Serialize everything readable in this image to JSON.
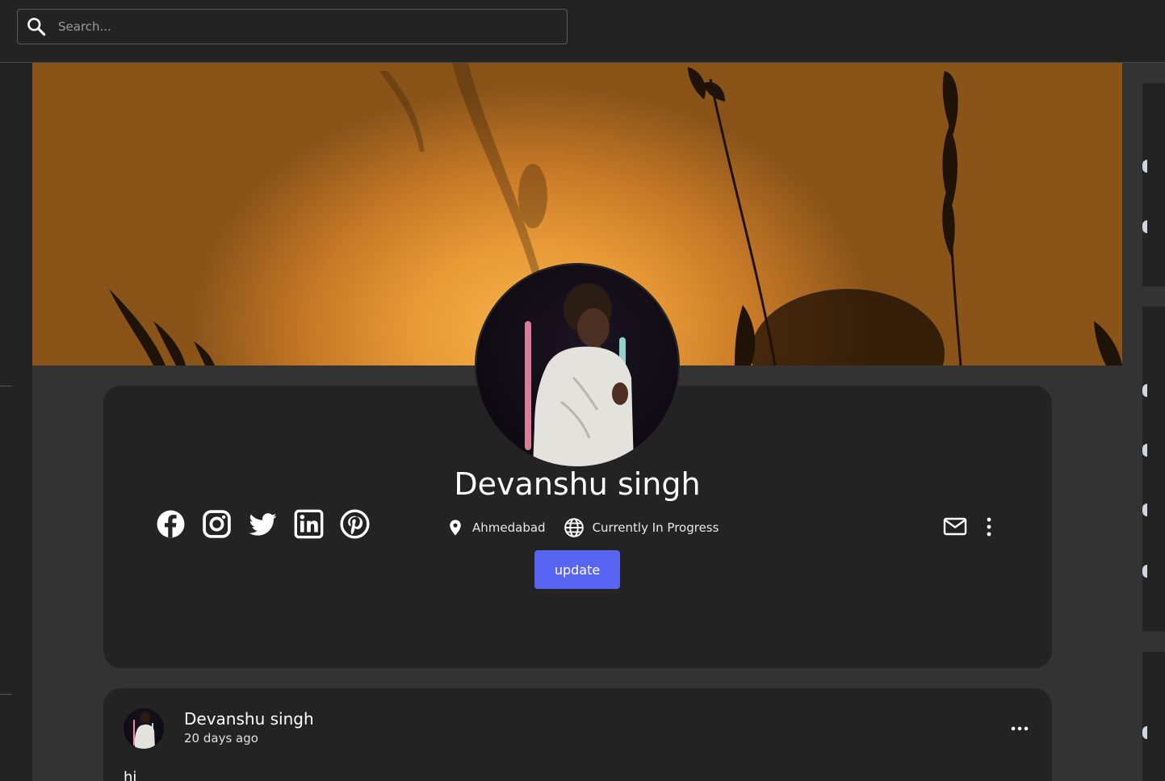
{
  "search": {
    "placeholder": "Search..."
  },
  "profile": {
    "name": "Devanshu singh",
    "location": "Ahmedabad",
    "website": "Currently In Progress",
    "update_label": "update",
    "socials": [
      "facebook-icon",
      "instagram-icon",
      "twitter-icon",
      "linkedin-icon",
      "pinterest-icon"
    ]
  },
  "post": {
    "author": "Devanshu singh",
    "time": "20 days ago",
    "body": "hi"
  },
  "colors": {
    "background": "#333333",
    "card": "#232323",
    "accent": "#5865f2"
  }
}
